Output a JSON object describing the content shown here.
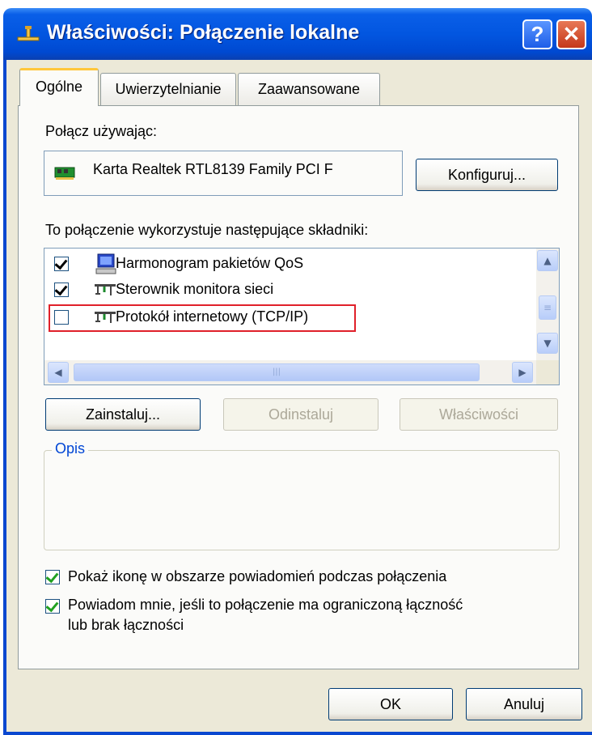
{
  "window": {
    "title": "Właściwości: Połączenie lokalne",
    "help_glyph": "?",
    "close_glyph": "✕",
    "accent": "#0256e0",
    "icon": "network-connection-icon"
  },
  "tabs": [
    {
      "label": "Ogólne",
      "active": true
    },
    {
      "label": "Uwierzytelnianie",
      "active": false
    },
    {
      "label": "Zaawansowane",
      "active": false
    }
  ],
  "general": {
    "connect_using_label": "Połącz używając:",
    "adapter_name": "Karta Realtek RTL8139 Family PCI F",
    "adapter_icon": "network-card-icon",
    "configure_button": "Konfiguruj...",
    "components_label": "To połączenie wykorzystuje następujące składniki:",
    "components": [
      {
        "label": "Harmonogram pakietów QoS",
        "checked": true,
        "icon": "qos-scheduler-icon"
      },
      {
        "label": "Sterownik monitora sieci",
        "checked": true,
        "icon": "protocol-icon"
      },
      {
        "label": "Protokół internetowy (TCP/IP)",
        "checked": false,
        "icon": "protocol-icon",
        "highlighted": true
      }
    ],
    "install_button": "Zainstaluj...",
    "uninstall_button": "Odinstaluj",
    "properties_button": "Właściwości",
    "description_label": "Opis",
    "show_icon_label": "Pokaż ikonę w obszarze powiadomień podczas połączenia",
    "show_icon_checked": true,
    "notify_label_line1": "Powiadom mnie, jeśli to połączenie ma ograniczoną łączność",
    "notify_label_line2": "lub brak łączności",
    "notify_checked": true
  },
  "footer": {
    "ok_button": "OK",
    "cancel_button": "Anuluj"
  }
}
